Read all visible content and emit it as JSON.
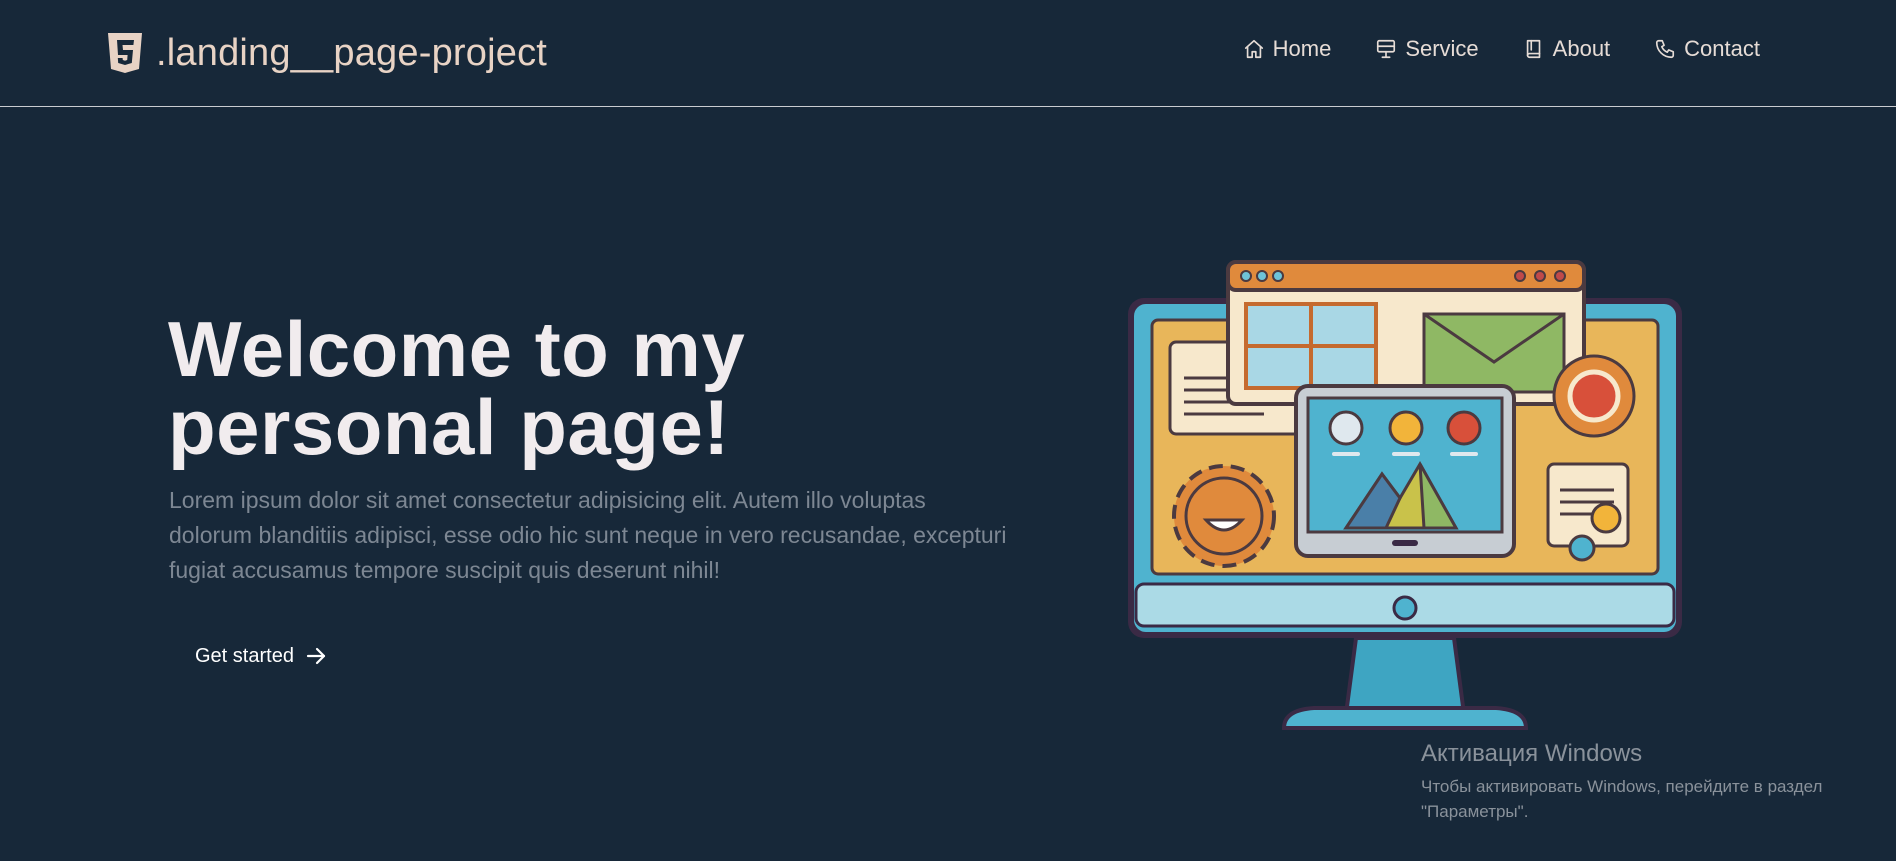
{
  "header": {
    "brand": {
      "icon": "html5-icon",
      "text": ".landing__page-project"
    },
    "nav": [
      {
        "label": "Home",
        "icon": "home-icon"
      },
      {
        "label": "Service",
        "icon": "monitor-icon"
      },
      {
        "label": "About",
        "icon": "book-icon"
      },
      {
        "label": "Contact",
        "icon": "phone-icon"
      }
    ]
  },
  "hero": {
    "title": "Welcome to my personal page!",
    "text": "Lorem ipsum dolor sit amet consectetur adipisicing elit. Autem illo voluptas dolorum blanditiis adipisci, esse odio hic sunt neque in vero recusandae, excepturi fugiat accusamus tempore suscipit quis deserunt nihil!",
    "cta_label": "Get started",
    "cta_icon": "arrow-right-icon",
    "illustration": "computer-monitor-illustration"
  },
  "activation": {
    "title": "Активация Windows",
    "text": "Чтобы активировать Windows, перейдите в раздел \"Параметры\"."
  },
  "colors": {
    "background": "#172839",
    "brand": "#e8d3c5",
    "title": "#f1ecee",
    "text_muted": "#7d8793"
  }
}
